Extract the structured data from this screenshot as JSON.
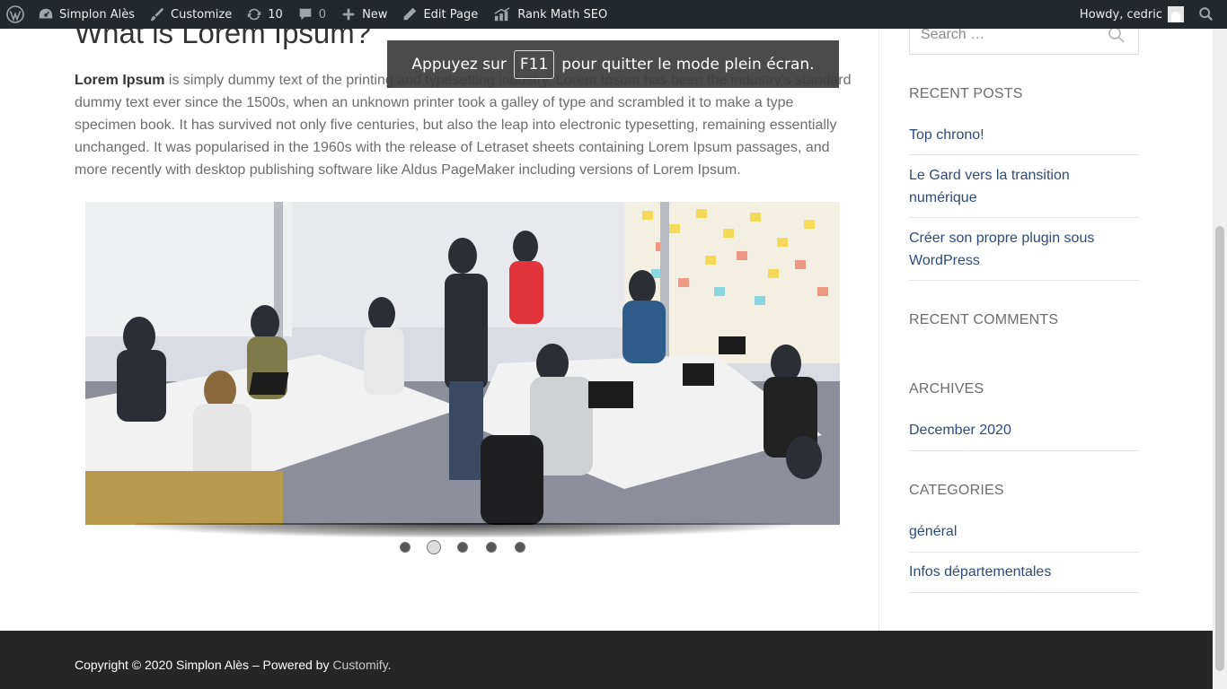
{
  "adminbar": {
    "site_name": "Simplon Alès",
    "customize": "Customize",
    "updates_count": "10",
    "comments_count": "0",
    "new": "New",
    "edit_page": "Edit Page",
    "seo": "Rank Math SEO",
    "howdy": "Howdy, cedric"
  },
  "overlay": {
    "before": "Appuyez sur",
    "key": "F11",
    "after": "pour quitter le mode plein écran."
  },
  "post": {
    "title": "What is Lorem Ipsum?",
    "bold": "Lorem Ipsum",
    "body": " is simply dummy text of the printing and typesetting industry. Lorem Ipsum has been the industry's standard dummy text ever since the 1500s, when an unknown printer took a galley of type and scrambled it to make a type specimen book. It has survived not only five centuries, but also the leap into electronic typesetting, remaining essentially unchanged. It was popularised in the 1960s with the release of Letraset sheets containing Lorem Ipsum passages, and more recently with desktop publishing software like Aldus PageMaker including versions of Lorem Ipsum."
  },
  "slider": {
    "slide_count": 5,
    "active_index": 1
  },
  "sidebar": {
    "search_placeholder": "Search …",
    "recent_posts_title": "RECENT POSTS",
    "recent_posts": [
      "Top chrono!",
      "Le Gard vers la transition numérique",
      "Créer son propre plugin sous WordPress"
    ],
    "recent_comments_title": "RECENT COMMENTS",
    "archives_title": "ARCHIVES",
    "archives": [
      "December 2020"
    ],
    "categories_title": "CATEGORIES",
    "categories": [
      "général",
      "Infos départementales"
    ]
  },
  "footer": {
    "text": "Copyright © 2020 Simplon Alès – Powered by ",
    "link": "Customify",
    "end": "."
  }
}
